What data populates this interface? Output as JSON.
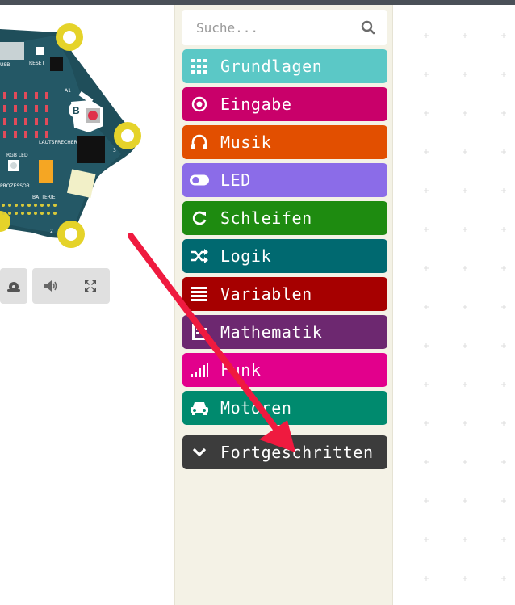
{
  "board": {
    "pin_labels": [
      "USB",
      "RESET",
      "A1",
      "B",
      "LAUTSPRECHER",
      "RGB LED",
      "3",
      "PROZESSOR",
      "BATTERIE",
      "2"
    ]
  },
  "simulator_controls": [
    {
      "name": "slow-motion-button",
      "icon": "snail-icon"
    },
    {
      "name": "mute-button",
      "icon": "speaker-icon"
    },
    {
      "name": "fullscreen-button",
      "icon": "fullscreen-icon"
    }
  ],
  "search": {
    "placeholder": "Suche..."
  },
  "categories": [
    {
      "label": "Grundlagen",
      "color": "#5bc8c6",
      "icon": "grid-icon"
    },
    {
      "label": "Eingabe",
      "color": "#c9006a",
      "icon": "target-icon"
    },
    {
      "label": "Musik",
      "color": "#e24f00",
      "icon": "headphones-icon"
    },
    {
      "label": "LED",
      "color": "#8b6ce8",
      "icon": "toggle-icon"
    },
    {
      "label": "Schleifen",
      "color": "#1e8b10",
      "icon": "refresh-icon"
    },
    {
      "label": "Logik",
      "color": "#006970",
      "icon": "shuffle-icon"
    },
    {
      "label": "Variablen",
      "color": "#a60000",
      "icon": "list-icon"
    },
    {
      "label": "Mathematik",
      "color": "#6d2870",
      "icon": "calculator-icon"
    },
    {
      "label": "Funk",
      "color": "#e2008c",
      "icon": "signal-icon"
    },
    {
      "label": "Motoren",
      "color": "#008a6e",
      "icon": "car-icon"
    },
    {
      "label": "Fortgeschritten",
      "color": "#3c3c3c",
      "icon": "chevron-down-icon"
    }
  ]
}
